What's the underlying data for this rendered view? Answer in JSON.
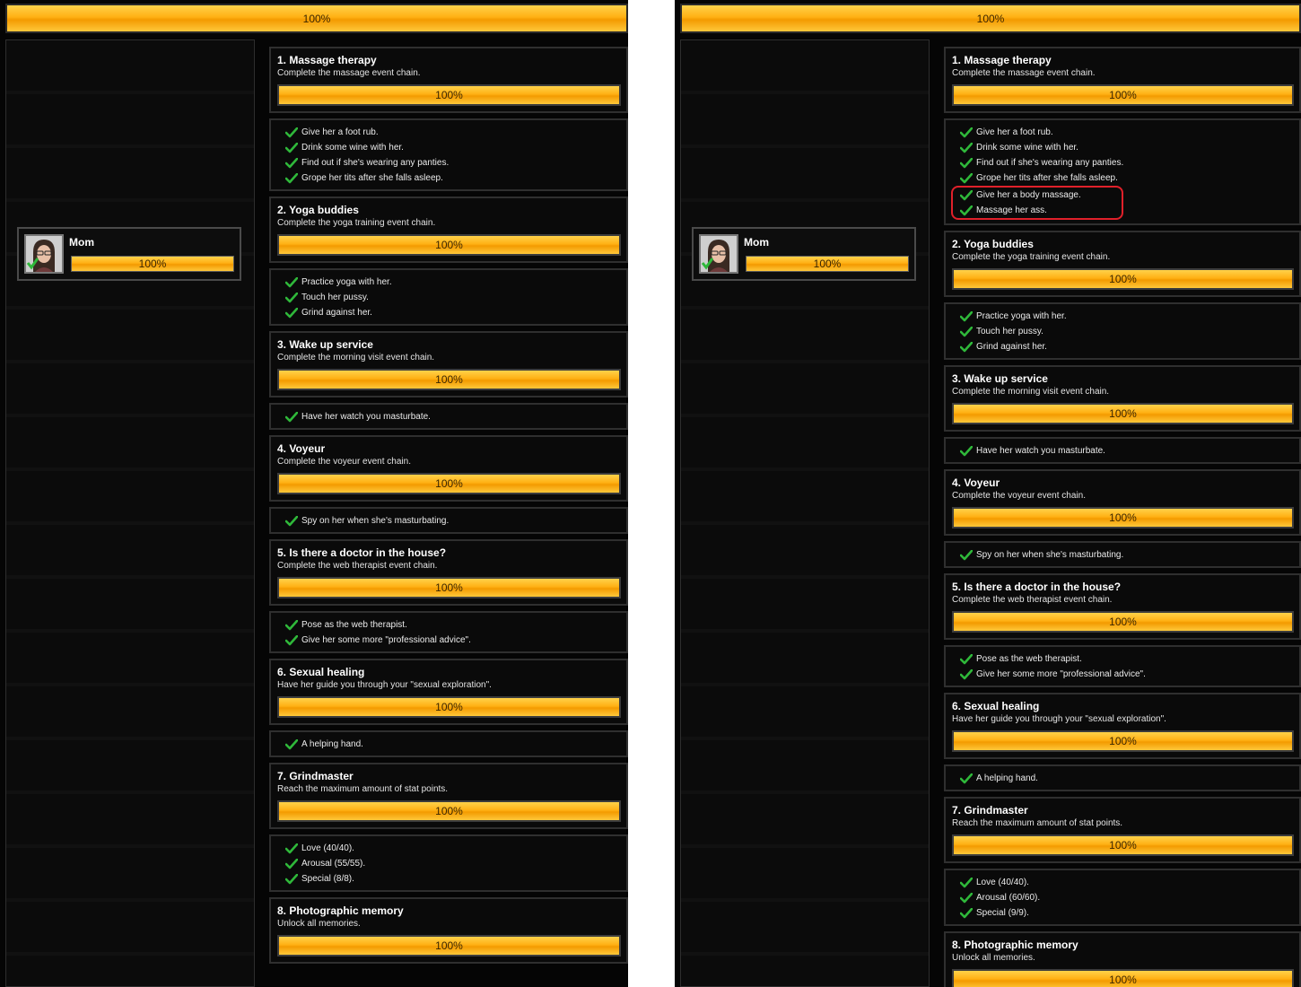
{
  "colors": {
    "accent": "#ffb014",
    "highlight": "#e0202a",
    "check": "#2fb83a"
  },
  "panels": [
    {
      "overall_progress": {
        "text": "100%",
        "fill": 1.0
      },
      "character": {
        "name": "Mom",
        "progress_text": "100%",
        "progress": 1.0
      },
      "achievements": [
        {
          "title": "1. Massage therapy",
          "desc": "Complete the massage event chain.",
          "progress_text": "100%",
          "progress": 1.0,
          "tasks": [
            "Give her a foot rub.",
            "Drink some wine with her.",
            "Find out if she's wearing any panties.",
            "Grope her tits after she falls asleep."
          ]
        },
        {
          "title": "2. Yoga buddies",
          "desc": "Complete the yoga training event chain.",
          "progress_text": "100%",
          "progress": 1.0,
          "tasks": [
            "Practice yoga with her.",
            "Touch her pussy.",
            "Grind against her."
          ]
        },
        {
          "title": "3. Wake up service",
          "desc": "Complete the morning visit event chain.",
          "progress_text": "100%",
          "progress": 1.0,
          "tasks": [
            "Have her watch you masturbate."
          ]
        },
        {
          "title": "4. Voyeur",
          "desc": "Complete the voyeur event chain.",
          "progress_text": "100%",
          "progress": 1.0,
          "tasks": [
            "Spy on her when she's masturbating."
          ]
        },
        {
          "title": "5. Is there a doctor in the house?",
          "desc": "Complete the web therapist event chain.",
          "progress_text": "100%",
          "progress": 1.0,
          "tasks": [
            "Pose as the web therapist.",
            "Give her some more \"professional advice\"."
          ]
        },
        {
          "title": "6. Sexual healing",
          "desc": "Have her guide you through your \"sexual exploration\".",
          "progress_text": "100%",
          "progress": 1.0,
          "tasks": [
            "A helping hand."
          ]
        },
        {
          "title": "7. Grindmaster",
          "desc": "Reach the maximum amount of stat points.",
          "progress_text": "100%",
          "progress": 1.0,
          "tasks": [
            "Love (40/40).",
            "Arousal (55/55).",
            "Special (8/8)."
          ]
        },
        {
          "title": "8. Photographic memory",
          "desc": "Unlock all memories.",
          "progress_text": "100%",
          "progress": 1.0,
          "tasks": []
        }
      ]
    },
    {
      "overall_progress": {
        "text": "100%",
        "fill": 1.0
      },
      "character": {
        "name": "Mom",
        "progress_text": "100%",
        "progress": 1.0
      },
      "achievements": [
        {
          "title": "1. Massage therapy",
          "desc": "Complete the massage event chain.",
          "progress_text": "100%",
          "progress": 1.0,
          "tasks": [
            "Give her a foot rub.",
            "Drink some wine with her.",
            "Find out if she's wearing any panties.",
            "Grope her tits after she falls asleep."
          ],
          "highlighted_tasks": [
            "Give her a body massage.",
            "Massage her ass."
          ]
        },
        {
          "title": "2. Yoga buddies",
          "desc": "Complete the yoga training event chain.",
          "progress_text": "100%",
          "progress": 1.0,
          "tasks": [
            "Practice yoga with her.",
            "Touch her pussy.",
            "Grind against her."
          ]
        },
        {
          "title": "3. Wake up service",
          "desc": "Complete the morning visit event chain.",
          "progress_text": "100%",
          "progress": 1.0,
          "tasks": [
            "Have her watch you masturbate."
          ]
        },
        {
          "title": "4. Voyeur",
          "desc": "Complete the voyeur event chain.",
          "progress_text": "100%",
          "progress": 1.0,
          "tasks": [
            "Spy on her when she's masturbating."
          ]
        },
        {
          "title": "5. Is there a doctor in the house?",
          "desc": "Complete the web therapist event chain.",
          "progress_text": "100%",
          "progress": 1.0,
          "tasks": [
            "Pose as the web therapist.",
            "Give her some more \"professional advice\"."
          ]
        },
        {
          "title": "6. Sexual healing",
          "desc": "Have her guide you through your \"sexual exploration\".",
          "progress_text": "100%",
          "progress": 1.0,
          "tasks": [
            "A helping hand."
          ]
        },
        {
          "title": "7. Grindmaster",
          "desc": "Reach the maximum amount of stat points.",
          "progress_text": "100%",
          "progress": 1.0,
          "tasks": [
            "Love (40/40).",
            "Arousal (60/60).",
            "Special (9/9)."
          ]
        },
        {
          "title": "8. Photographic memory",
          "desc": "Unlock all memories.",
          "progress_text": "100%",
          "progress": 1.0,
          "tasks": []
        }
      ]
    }
  ]
}
